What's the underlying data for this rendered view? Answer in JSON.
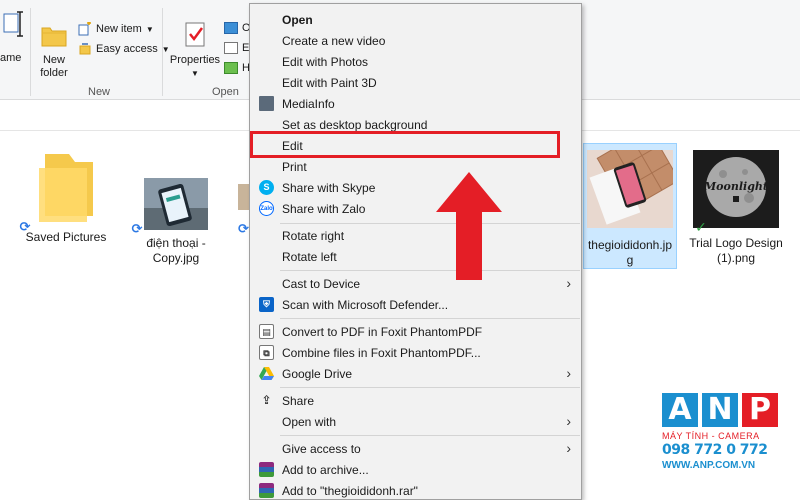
{
  "ribbon": {
    "rename_label": "ame",
    "new_folder_label_line1": "New",
    "new_folder_label_line2": "folder",
    "new_item_label": "New item",
    "easy_access_label": "Easy access",
    "properties_label": "Properties",
    "open_small_1": "O",
    "open_small_2": "E",
    "open_small_3": "H",
    "group_new": "New",
    "group_open": "Open"
  },
  "files": [
    {
      "label_line1": "Saved Pictures",
      "label_line2": ""
    },
    {
      "label_line1": "điện thoại -",
      "label_line2": "Copy.jpg"
    },
    {
      "label_line1": "thegioididonh.jp",
      "label_line2": "g"
    },
    {
      "label_line1": "Trial Logo Design",
      "label_line2": "(1).png"
    }
  ],
  "thumbnail_text": "Moonlight",
  "context_menu": {
    "items": [
      {
        "label": "Open"
      },
      {
        "label": "Create a new video"
      },
      {
        "label": "Edit with Photos"
      },
      {
        "label": "Edit with Paint 3D"
      },
      {
        "label": "MediaInfo"
      },
      {
        "label": "Set as desktop background"
      },
      {
        "label": "Edit"
      },
      {
        "label": "Print"
      },
      {
        "label": "Share with Skype"
      },
      {
        "label": "Share with Zalo"
      },
      {
        "label": "Rotate right"
      },
      {
        "label": "Rotate left"
      },
      {
        "label": "Cast to Device"
      },
      {
        "label": "Scan with Microsoft Defender..."
      },
      {
        "label": "Convert to PDF in Foxit PhantomPDF"
      },
      {
        "label": "Combine files in Foxit PhantomPDF..."
      },
      {
        "label": "Google Drive"
      },
      {
        "label": "Share"
      },
      {
        "label": "Open with"
      },
      {
        "label": "Give access to"
      },
      {
        "label": "Add to archive..."
      },
      {
        "label": "Add to \"thegioididonh.rar\""
      }
    ],
    "zalo_icon_text": "Zalo"
  },
  "logo": {
    "letter_a": "A",
    "letter_n": "N",
    "letter_p": "P",
    "subtitle": "MÁY TÍNH - CAMERA",
    "phone": "098 772 0 772",
    "website": "WWW.ANP.COM.VN"
  },
  "colors": {
    "highlight": "#e41e26",
    "accent_blue": "#1b8fcf",
    "selection": "#cce8ff"
  }
}
